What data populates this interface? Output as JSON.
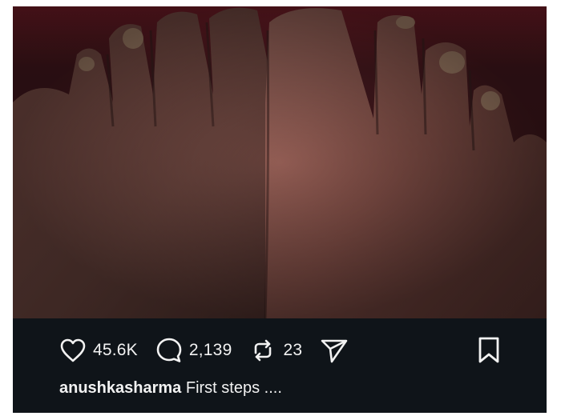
{
  "post": {
    "image_alt": "",
    "actions": {
      "likes": "45.6K",
      "comments": "2,139",
      "reposts": "23"
    },
    "caption": {
      "username": "anushkasharma",
      "text": "First steps ...."
    }
  },
  "icons": {
    "like": "heart-icon",
    "comment": "comment-bubble-icon",
    "repost": "repost-icon",
    "share": "send-icon",
    "save": "bookmark-icon"
  },
  "colors": {
    "background": "#0f1419",
    "text": "#f2f2f2",
    "photo_base": "#5a1f26"
  }
}
